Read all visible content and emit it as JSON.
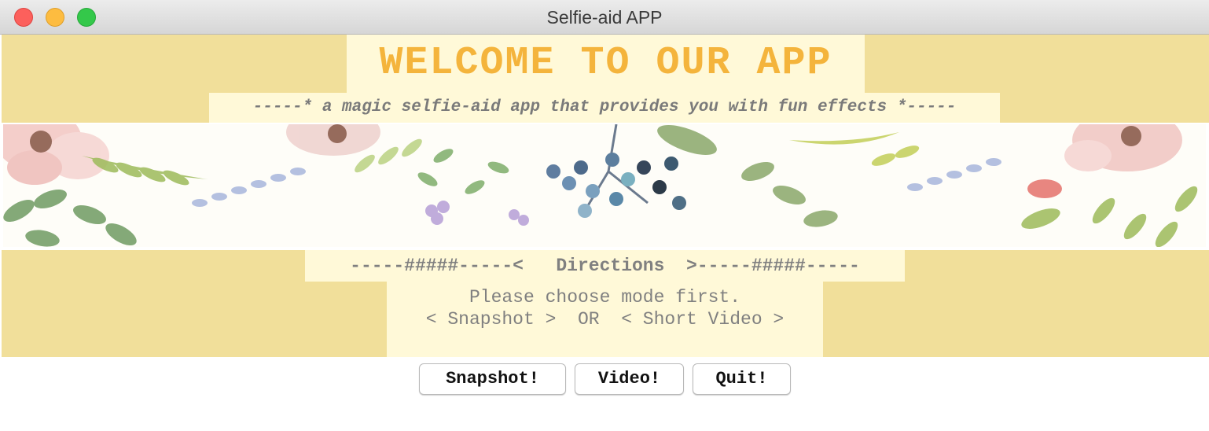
{
  "window": {
    "title": "Selfie-aid APP"
  },
  "header": {
    "welcome": "WELCOME TO OUR APP",
    "tagline": "-----* a magic selfie-aid app that provides you with fun effects *-----"
  },
  "directions": {
    "heading": "-----#####-----<   Directions  >-----#####-----",
    "line1": "Please choose mode first.",
    "line2": "< Snapshot >  OR  < Short Video >"
  },
  "buttons": {
    "snapshot": "Snapshot!",
    "video": "Video!",
    "quit": "Quit!"
  },
  "colors": {
    "band_yellow": "#f1df9a",
    "label_cream": "#fff9d8",
    "welcome_orange": "#f4b43c",
    "text_gray": "#808080"
  },
  "icons": {
    "close": "close-icon",
    "minimize": "minimize-icon",
    "maximize": "maximize-icon",
    "banner": "floral-banner-image"
  }
}
